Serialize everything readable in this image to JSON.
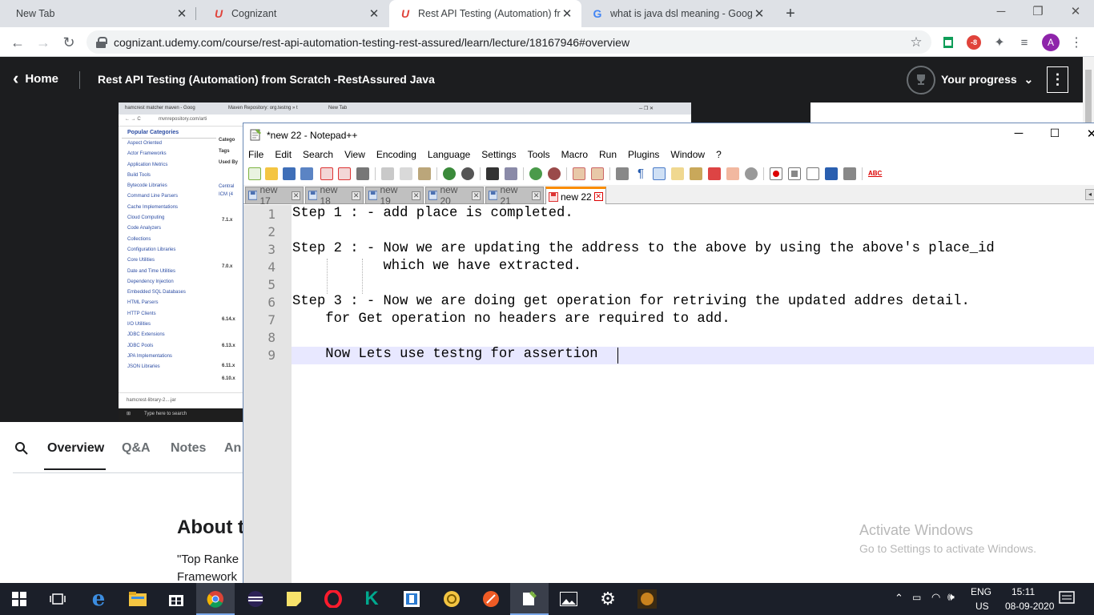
{
  "browser": {
    "tabs": [
      {
        "title": "New Tab",
        "active": false
      },
      {
        "title": "Cognizant",
        "active": false
      },
      {
        "title": "Rest API Testing (Automation) fro",
        "active": true
      },
      {
        "title": "what is java dsl meaning - Googl",
        "active": false
      }
    ],
    "new_tab": "+",
    "url": "cognizant.udemy.com/course/rest-api-automation-testing-rest-assured/learn/lecture/18167946#overview",
    "profile_initial": "A",
    "extension_badge": "-8"
  },
  "udemy": {
    "home_label": "Home",
    "course_title": "Rest API Testing (Automation) from Scratch -RestAssured Java",
    "progress_label": "Your progress",
    "tabs": [
      "Overview",
      "Q&A",
      "Notes",
      "An"
    ],
    "about_heading": "About t",
    "about_line1": "\"Top Ranke",
    "about_line2": "Framework"
  },
  "video": {
    "tabs": [
      "hamcrest matcher maven - Goog",
      "Maven Repository: org.testng » t",
      "New Tab"
    ],
    "address": "mvnrepository.com/arti",
    "sidebar_heading": "Popular Categories",
    "categories": [
      "Aspect Oriented",
      "Actor Frameworks",
      "Application Metrics",
      "Build Tools",
      "Bytecode Libraries",
      "Command Line Parsers",
      "Cache Implementations",
      "Cloud Computing",
      "Code Analyzers",
      "Collections",
      "Configuration Libraries",
      "Core Utilities",
      "Date and Time Utilities",
      "Dependency Injection",
      "Embedded SQL Databases",
      "HTML Parsers",
      "HTTP Clients",
      "I/O Utilities",
      "JDBC Extensions",
      "JDBC Pools",
      "JPA Implementations",
      "JSON Libraries"
    ],
    "mid_labels": [
      "Catego",
      "Tags",
      "Used By",
      "Central",
      "ICM (4"
    ],
    "versions": [
      "7.1.x",
      "7.0.x",
      "6.14.x",
      "6.13.x",
      "6.11.x",
      "6.10.x"
    ],
    "download": "hamcrest-library-2....jar",
    "search_placeholder": "Type here to search"
  },
  "notepad": {
    "title": "*new 22 - Notepad++",
    "menu": [
      "File",
      "Edit",
      "Search",
      "View",
      "Encoding",
      "Language",
      "Settings",
      "Tools",
      "Macro",
      "Run",
      "Plugins",
      "Window",
      "?"
    ],
    "tabs": [
      "new 17",
      "new 18",
      "new 19",
      "new 20",
      "new 21",
      "new 22"
    ],
    "active_tab": "new 22",
    "lines": [
      {
        "n": "1",
        "text": "Step 1 : - add place is completed."
      },
      {
        "n": "2",
        "text": ""
      },
      {
        "n": "3",
        "text": "Step 2 : - Now we are updating the address to the above by using the above's place_id"
      },
      {
        "n": "4",
        "text": "           which we have extracted."
      },
      {
        "n": "5",
        "text": ""
      },
      {
        "n": "6",
        "text": "Step 3 : - Now we are doing get operation for retriving the updated addres detail."
      },
      {
        "n": "7",
        "text": "    for Get operation no headers are required to add."
      },
      {
        "n": "8",
        "text": ""
      },
      {
        "n": "9",
        "text": "    Now Lets use testng for assertion"
      }
    ],
    "spell_label": "ABC"
  },
  "watermark": {
    "line1": "Activate Windows",
    "line2": "Go to Settings to activate Windows."
  },
  "taskbar": {
    "lang1": "ENG",
    "lang2": "US",
    "time": "15:11",
    "date": "08-09-2020"
  },
  "colors": {
    "udemy_dark": "#1c1d1f",
    "udemy_purple": "#a435f0",
    "npp_tab_accent": "#fa8c00",
    "taskbar": "#1b1f29"
  }
}
